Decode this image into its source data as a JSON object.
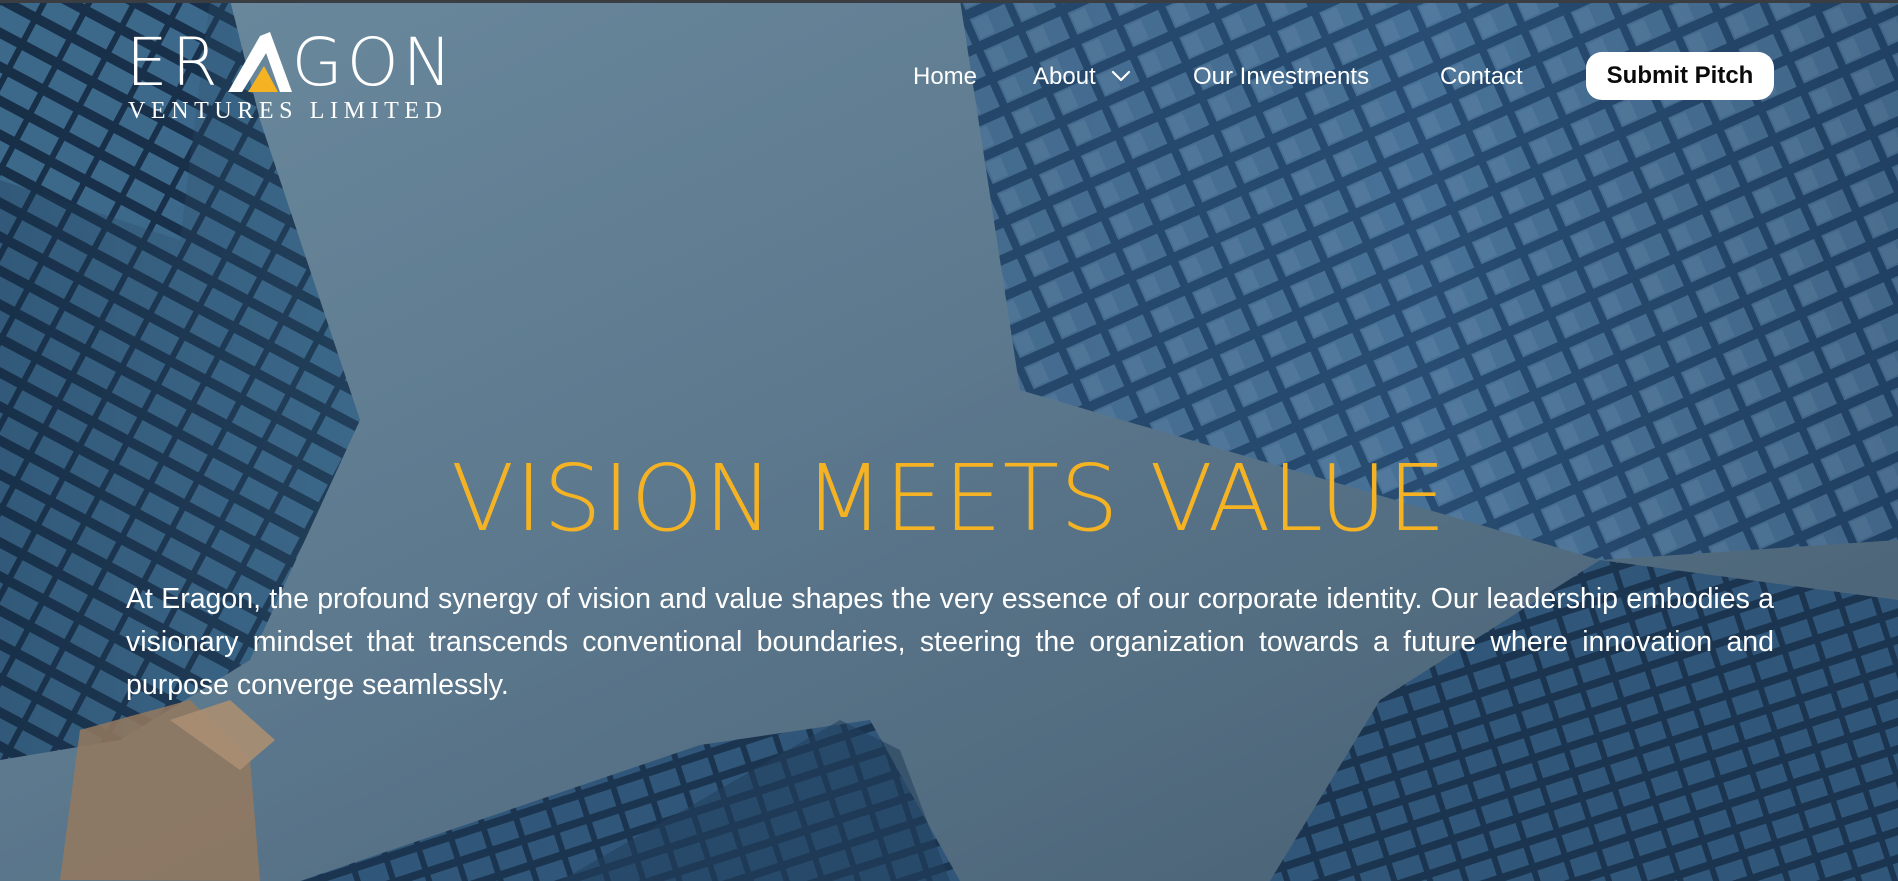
{
  "brand": {
    "name_main": "ERAGON",
    "name_left": "ER",
    "name_right": "GON",
    "tagline": "VENTURES LIMITED"
  },
  "nav": {
    "items": [
      {
        "label": "Home"
      },
      {
        "label": "About"
      },
      {
        "label": "Our Investments"
      },
      {
        "label": "Contact"
      }
    ],
    "cta_label": "Submit Pitch"
  },
  "hero": {
    "title": "VISION MEETS VALUE",
    "description": "At Eragon, the profound synergy of vision and value shapes the very essence of our corporate identity. Our leadership embodies a visionary mindset that transcends conventional boundaries, steering the organization towards a future where innovation and purpose converge seamlessly.",
    "background": "skyscrapers-photo"
  },
  "colors": {
    "accent": "#f5b324",
    "text_light": "#ffffff",
    "button_bg": "#ffffff",
    "button_text": "#0a0a0a"
  },
  "icons": {
    "about_dropdown": "chevron-down-icon",
    "logo_mark": "triangle-logo-icon"
  }
}
